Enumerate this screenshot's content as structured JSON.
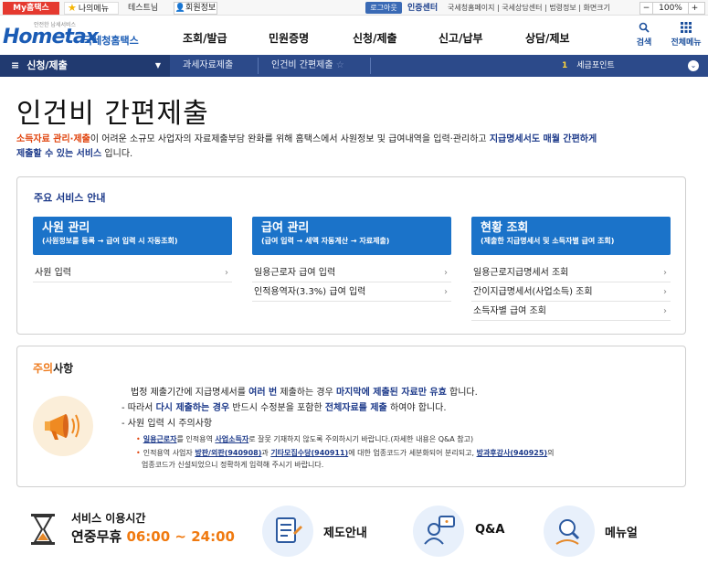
{
  "topbar": {
    "my_hometax": "My홈택스",
    "my_menu": "나의메뉴",
    "test_name": "테스트님",
    "member_info": "회원정보",
    "logout": "로그아웃",
    "cert_center": "인증센터",
    "links": "국세청홈페이지 | 국세상담센터 | 법령정보 | 화면크기",
    "zoom_minus": "−",
    "zoom": "100%",
    "zoom_plus": "+"
  },
  "header": {
    "logo_small": "안전한 납세서비스",
    "logo_text": "Hometax",
    "logo_kor": "국세청홈택스",
    "menu": [
      "조회/발급",
      "민원증명",
      "신청/제출",
      "신고/납부",
      "상담/제보"
    ],
    "search": "검색",
    "all_menu": "전체메뉴"
  },
  "navbar": {
    "section": "신청/제출",
    "crumbs": [
      "과세자료제출",
      "인건비 간편제출"
    ],
    "tax_point_num": "1",
    "tax_point": "세금포인트"
  },
  "title": "인건비 간편제출",
  "intro": {
    "part1": "소득자료 관리·제출",
    "part2": "이 어려운 소규모 사업자의 자료제출부담 완화를 위해 홈택스에서 사원정보 및 급여내역을 입력·관리하고 ",
    "part3": "지급명세서도 매월 간편하게",
    "part4": "제출할 수 있는 서비스",
    "part5": " 입니다."
  },
  "services": {
    "title": "주요 서비스 안내",
    "columns": [
      {
        "heading": "사원 관리",
        "sub": "(사원정보를 등록 → 급여 입력 시 자동조회)",
        "items": [
          "사원 입력"
        ]
      },
      {
        "heading": "급여 관리",
        "sub": "(급여 입력 → 세액 자동계산 → 자료제출)",
        "items": [
          "일용근로자 급여 입력",
          "인적용역자(3.3%) 급여 입력"
        ]
      },
      {
        "heading": "현황 조회",
        "sub": "(제출한 지급명세서 및 소득자별 급여 조회)",
        "items": [
          "일용근로지급명세서 조회",
          "간이지급명세서(사업소득) 조회",
          "소득자별 급여 조회"
        ]
      }
    ]
  },
  "notice": {
    "title_a": "주의",
    "title_b": "사항",
    "line1": [
      "법정 제출기간에 지급명세서를 ",
      "여러 번",
      " 제출하는 경우 ",
      "마지막에 제출된 자료만 유효",
      " 합니다."
    ],
    "line2": [
      "- 따라서 ",
      "다시 제출하는 경우",
      " 반드시 수정분을 포함한 ",
      "전체자료를 제출",
      " 하여야 합니다."
    ],
    "line3": "- 사원 입력 시 주의사항",
    "sub1": [
      "일용근로자",
      "를 인적용역 ",
      "사업소득자",
      "로 잘못 기재하지 않도록 주의하시기 바랍니다.(자세한 내용은 Q&A 참고)"
    ],
    "sub2": [
      "인적용역 사업자 ",
      "방판/외판(940908)",
      "과 ",
      "기타모집수당(940911)",
      "에 대한 업종코드가 세분화되어 분리되고, ",
      "방과후강사(940925)",
      "의"
    ],
    "sub3": "업종코드가 신설되었으니 정확하게 입력해 주시기 바랍니다."
  },
  "footer": {
    "time_label": "서비스 이용시간",
    "time_prefix": "연중무휴 ",
    "time_hours": "06:00 ~ 24:00",
    "guide": "제도안내",
    "qa": "Q&A",
    "manual": "메뉴얼"
  }
}
